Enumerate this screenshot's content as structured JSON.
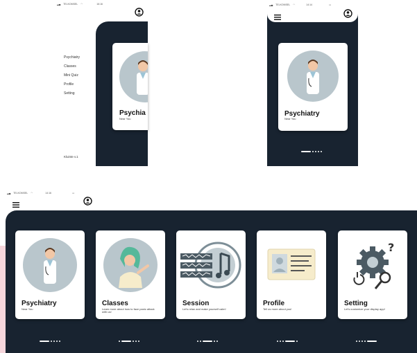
{
  "status": {
    "carrier": "TELKOMSEL",
    "time_screen1": "16:16",
    "time_screen2": "14:14",
    "time_screen3": "14:16"
  },
  "drawer_menu": {
    "items": [
      "Psychiatry",
      "Classes",
      "Mini Quiz",
      "Profile",
      "Setting"
    ],
    "version": "Kluinte v.1"
  },
  "cards": [
    {
      "title": "Psychiatry",
      "subtitle": "Near You"
    },
    {
      "title": "Classes",
      "subtitle": "Learn more about how to face panic attack with us!"
    },
    {
      "title": "Session",
      "subtitle": "Let's relax and make yourself calm!"
    },
    {
      "title": "Profile",
      "subtitle": "Tell us more about you!"
    },
    {
      "title": "Setting",
      "subtitle": "Let's customize your display app!"
    }
  ],
  "peek_card": {
    "title": "Psychia",
    "subtitle": "Near You"
  },
  "colors": {
    "dark": "#182330",
    "accent_pink": "#f6d6dc"
  },
  "icons": [
    "hamburger-icon",
    "user-avatar-icon",
    "signal-icon",
    "wifi-icon",
    "battery-icon",
    "gear-icon",
    "music-note-icon",
    "id-card-icon"
  ]
}
